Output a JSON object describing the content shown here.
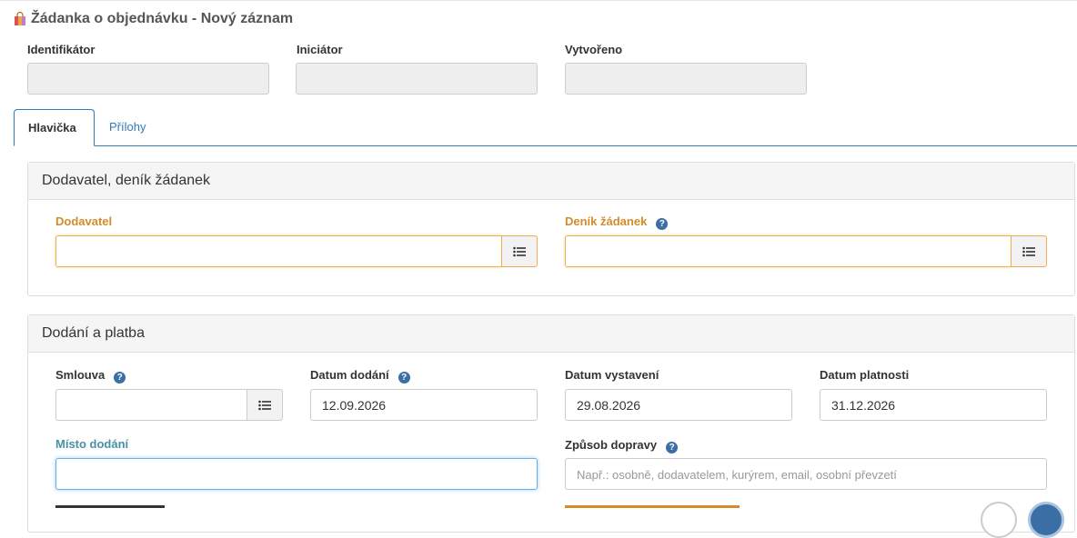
{
  "page": {
    "title": "Žádanka o objednávku - Nový záznam",
    "icon": "shopping-bag-icon"
  },
  "header_fields": {
    "identifikator_label": "Identifikátor",
    "iniciator_label": "Iniciátor",
    "vytvoreno_label": "Vytvořeno"
  },
  "tabs": [
    {
      "label": "Hlavička",
      "active": true
    },
    {
      "label": "Přílohy",
      "active": false
    }
  ],
  "panel_supplier": {
    "heading": "Dodavatel, deník žádanek",
    "dodavatel_label": "Dodavatel",
    "denik_label": "Deník žádanek"
  },
  "panel_delivery": {
    "heading": "Dodání a platba",
    "smlouva_label": "Smlouva",
    "datum_dodani_label": "Datum dodání",
    "datum_dodani_value": "12.09.2026",
    "datum_vystaveni_label": "Datum vystavení",
    "datum_vystaveni_value": "29.08.2026",
    "datum_platnosti_label": "Datum platnosti",
    "datum_platnosti_value": "31.12.2026",
    "misto_dodani_label": "Místo dodání",
    "zpusob_dopravy_label": "Způsob dopravy",
    "zpusob_dopravy_placeholder": "Např.: osobně, dodavatelem, kurýrem, email, osobní převzetí"
  },
  "icons": {
    "help": "question-circle-icon",
    "list": "list-icon"
  },
  "colors": {
    "accent_blue": "#337ab7",
    "warning_orange": "#d48b2a",
    "teal_label": "#4a90a4",
    "help_icon": "#3a6ea5"
  }
}
